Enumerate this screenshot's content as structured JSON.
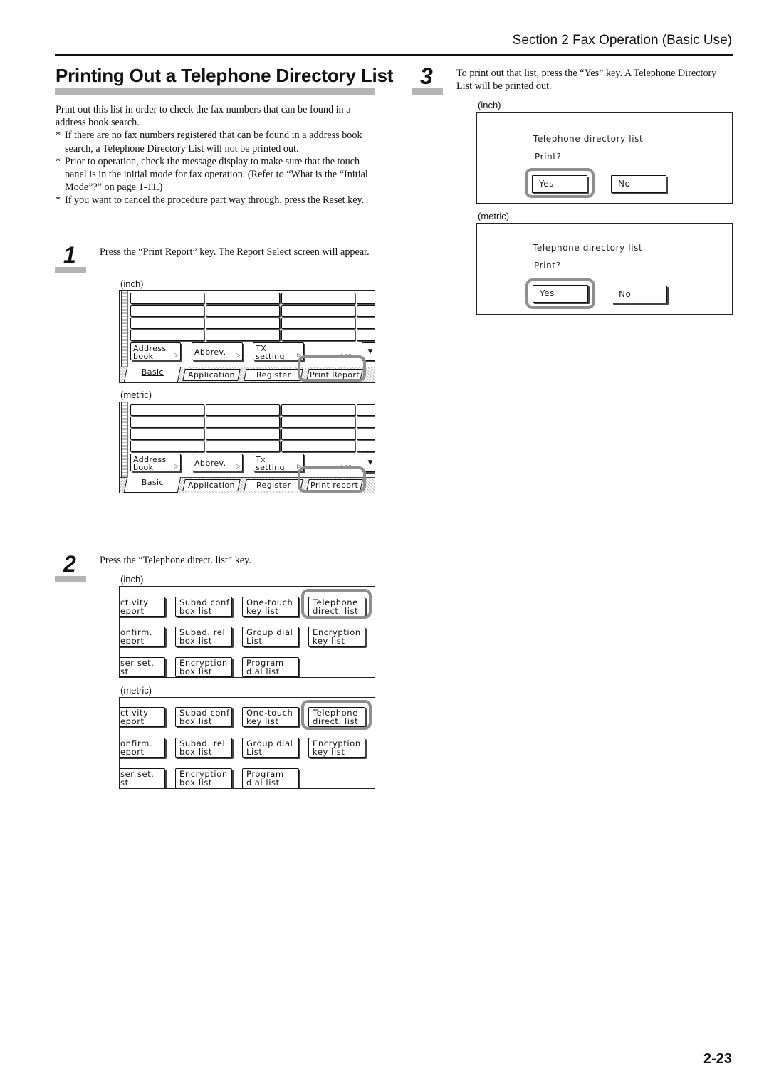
{
  "header": {
    "section": "Section 2  Fax Operation (Basic Use)"
  },
  "title": "Printing Out a Telephone Directory List",
  "intro": {
    "paragraph": "Print out this list in order to check the fax numbers that can be found in a address book search.",
    "notes": [
      "If there are no fax numbers registered that can be found in a address book search, a Telephone Directory List will not be printed out.",
      "Prior to operation, check the message display to make sure that the touch panel is in the initial mode for fax operation. (Refer to “What is the “Initial Mode”?” on page 1-11.)",
      "If you want to cancel the procedure part way through, press the Reset key."
    ],
    "note_marker": "*"
  },
  "steps": [
    {
      "number": "1",
      "text": "Press the “Print Report” key. The Report Select screen will appear.",
      "screens": [
        {
          "unit": "(inch)",
          "keys": [
            {
              "line1": "Address",
              "line2": "book",
              "arrow": "▷"
            },
            {
              "line1": "Abbrev.",
              "line2": "",
              "arrow": "▷"
            },
            {
              "line1": "TX",
              "line2": "setting",
              "arrow": "▷"
            }
          ],
          "pager": "1/00",
          "scroll": "▼",
          "tabs": [
            "Basic",
            "Application",
            "Register",
            "Print Report"
          ]
        },
        {
          "unit": "(metric)",
          "keys": [
            {
              "line1": "Address",
              "line2": "book",
              "arrow": "▷"
            },
            {
              "line1": "Abbrev.",
              "line2": "",
              "arrow": "▷"
            },
            {
              "line1": "Tx",
              "line2": "setting",
              "arrow": "▷"
            }
          ],
          "pager": "1/00",
          "scroll": "▼",
          "tabs": [
            "Basic",
            "Application",
            "Register",
            "Print report"
          ]
        }
      ]
    },
    {
      "number": "2",
      "text": "Press the “Telephone direct. list” key.",
      "screens": [
        {
          "unit": "(inch)",
          "keys": [
            {
              "line1": "ctivity",
              "line2": "eport"
            },
            {
              "line1": "Subad conf",
              "line2": "box list"
            },
            {
              "line1": "One-touch",
              "line2": "key list"
            },
            {
              "line1": "Telephone",
              "line2": "direct. list"
            },
            {
              "line1": "onfirm.",
              "line2": "eport"
            },
            {
              "line1": "Subad. rel",
              "line2": "box list"
            },
            {
              "line1": "Group dial",
              "line2": "List"
            },
            {
              "line1": "Encryption",
              "line2": "key list"
            },
            {
              "line1": "ser set.",
              "line2": "st"
            },
            {
              "line1": "Encryption",
              "line2": "box list"
            },
            {
              "line1": "Program",
              "line2": "dial list"
            }
          ]
        },
        {
          "unit": "(metric)",
          "keys": [
            {
              "line1": "ctivity",
              "line2": "eport"
            },
            {
              "line1": "Subad conf",
              "line2": "box list"
            },
            {
              "line1": "One-touch",
              "line2": "key list"
            },
            {
              "line1": "Telephone",
              "line2": "direct. list"
            },
            {
              "line1": "onfirm.",
              "line2": "eport"
            },
            {
              "line1": "Subad. rel",
              "line2": "box list"
            },
            {
              "line1": "Group dial",
              "line2": "List"
            },
            {
              "line1": "Encryption",
              "line2": "key list"
            },
            {
              "line1": "ser set.",
              "line2": "st"
            },
            {
              "line1": "Encryption",
              "line2": "box list"
            },
            {
              "line1": "Program",
              "line2": "dial list"
            }
          ]
        }
      ]
    },
    {
      "number": "3",
      "text": "To print out that list, press the “Yes” key. A Telephone Directory List will be printed out.",
      "screens": [
        {
          "unit": "(inch)",
          "title": "Telephone directory list",
          "prompt": "Print?",
          "yes": "Yes",
          "no": "No"
        },
        {
          "unit": "(metric)",
          "title": "Telephone directory list",
          "prompt": "Print?",
          "yes": "Yes",
          "no": "No"
        }
      ]
    }
  ],
  "page_number": "2-23"
}
